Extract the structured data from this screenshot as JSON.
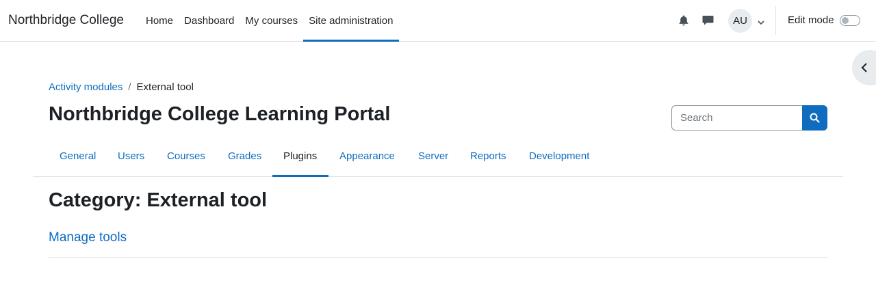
{
  "brand": {
    "name": "Northbridge College"
  },
  "primary_nav": [
    {
      "label": "Home",
      "active": false
    },
    {
      "label": "Dashboard",
      "active": false
    },
    {
      "label": "My courses",
      "active": false
    },
    {
      "label": "Site administration",
      "active": true
    }
  ],
  "user": {
    "initials": "AU"
  },
  "edit_mode": {
    "label": "Edit mode",
    "enabled": false
  },
  "breadcrumb": {
    "link": "Activity modules",
    "separator": "/",
    "current": "External tool"
  },
  "page": {
    "title": "Northbridge College Learning Portal"
  },
  "search": {
    "placeholder": "Search"
  },
  "secondary_nav": [
    {
      "label": "General",
      "active": false
    },
    {
      "label": "Users",
      "active": false
    },
    {
      "label": "Courses",
      "active": false
    },
    {
      "label": "Grades",
      "active": false
    },
    {
      "label": "Plugins",
      "active": true
    },
    {
      "label": "Appearance",
      "active": false
    },
    {
      "label": "Server",
      "active": false
    },
    {
      "label": "Reports",
      "active": false
    },
    {
      "label": "Development",
      "active": false
    }
  ],
  "content": {
    "category_heading": "Category: External tool",
    "link": "Manage tools"
  },
  "icons": [
    "bell-icon",
    "chat-icon",
    "chevron-down-icon",
    "chevron-left-icon",
    "search-icon"
  ],
  "colors": {
    "accent": "#0f6cbf",
    "text": "#1d2125",
    "border": "#dee2e6"
  }
}
